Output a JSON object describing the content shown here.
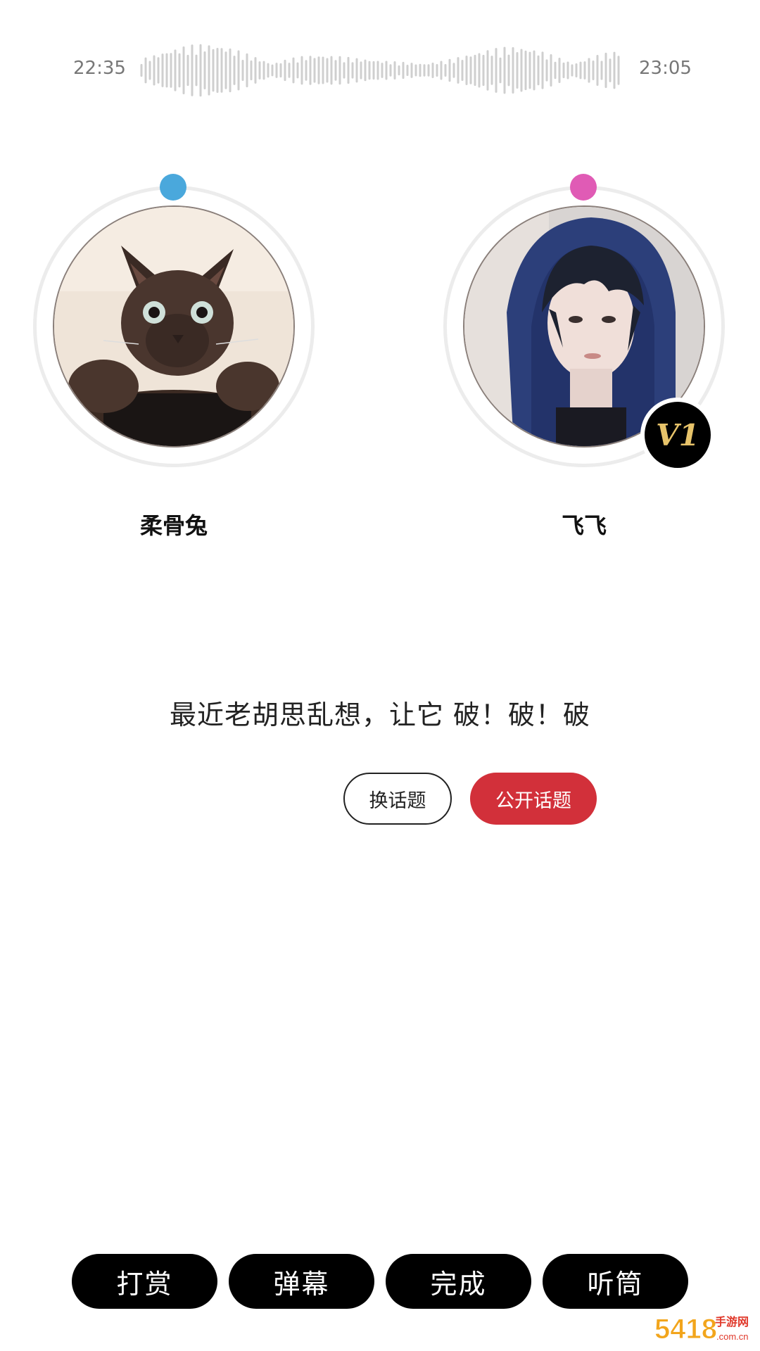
{
  "timeline": {
    "start_time": "22:35",
    "end_time": "23:05"
  },
  "participants": [
    {
      "name": "柔骨兔",
      "indicator_color": "#4aa8dc",
      "avatar_icon": "cat-photo"
    },
    {
      "name": "飞飞",
      "indicator_color": "#e05bb5",
      "avatar_icon": "hooded-person-photo",
      "vip_badge": "V1"
    }
  ],
  "topic": {
    "text": "最近老胡思乱想，让它 破！破！破",
    "change_label": "换话题",
    "public_label": "公开话题",
    "public_color": "#d2303a"
  },
  "bottom_bar": {
    "items": [
      {
        "label": "打赏"
      },
      {
        "label": "弹幕"
      },
      {
        "label": "完成"
      },
      {
        "label": "听筒"
      }
    ]
  },
  "watermark": {
    "text_main": "5418",
    "text_sub": "手游网",
    "text_domain": ".com.cn"
  }
}
